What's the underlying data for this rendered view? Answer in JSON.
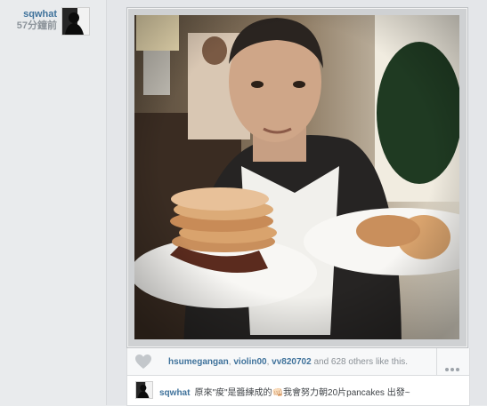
{
  "post": {
    "username": "sqwhat",
    "timestamp": "57分鐘前"
  },
  "photo": {
    "alt_icon": "photo-image"
  },
  "likes": {
    "users": [
      "hsumegangan",
      "violin00",
      "vv820702"
    ],
    "separator": ", ",
    "and_text": " and ",
    "count": "628",
    "suffix": " others like this."
  },
  "caption": {
    "username": "sqwhat",
    "text": "原來\"痠\"是醬練成的👊🏻我會努力朝20片pancakes 出發~"
  },
  "icons": {
    "like": "heart-icon",
    "more": "more-dots-icon"
  },
  "colors": {
    "link": "#3f729b",
    "background": "#e9ebed"
  }
}
